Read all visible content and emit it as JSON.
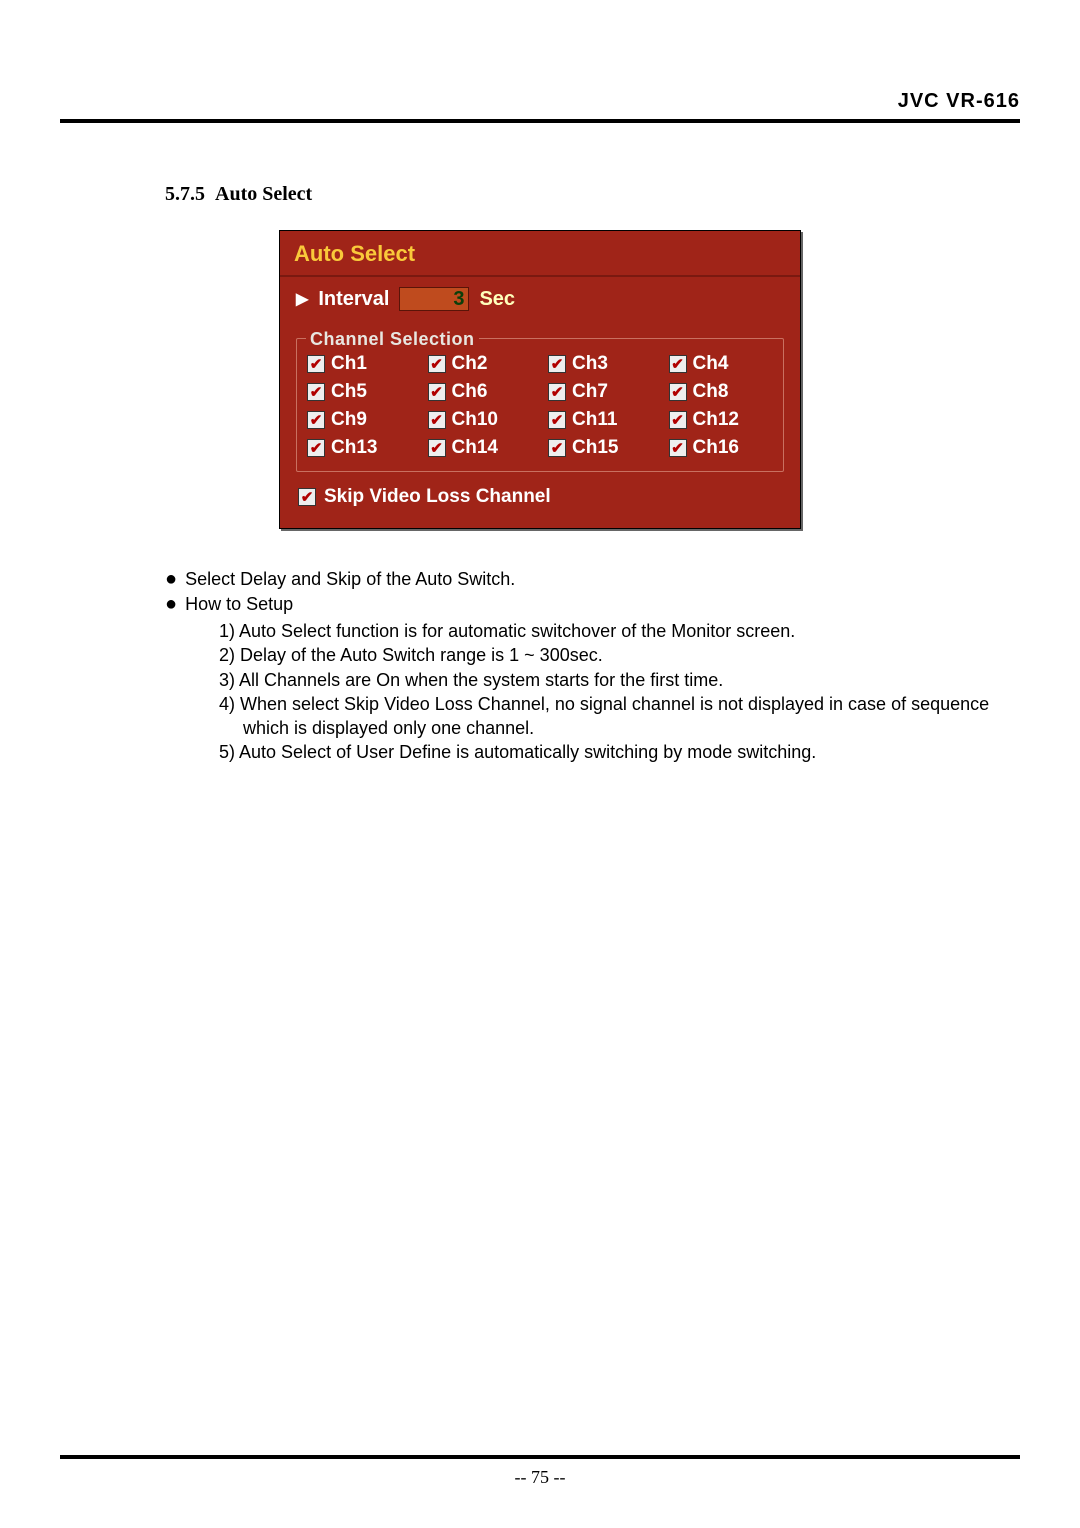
{
  "header": {
    "device": "JVC VR-616"
  },
  "section": {
    "num": "5.7.5",
    "title": "Auto Select"
  },
  "osd": {
    "title": "Auto Select",
    "interval_label": "Interval",
    "interval_value": "3",
    "interval_unit": "Sec",
    "channel_selection_label": "Channel Selection",
    "channels": [
      "Ch1",
      "Ch2",
      "Ch3",
      "Ch4",
      "Ch5",
      "Ch6",
      "Ch7",
      "Ch8",
      "Ch9",
      "Ch10",
      "Ch11",
      "Ch12",
      "Ch13",
      "Ch14",
      "Ch15",
      "Ch16"
    ],
    "skip_label": "Skip Video Loss Channel"
  },
  "notes": {
    "bullet1": "Select Delay and Skip of the Auto Switch.",
    "bullet2": "How to Setup",
    "setup": [
      "1) Auto Select function is for automatic switchover of the Monitor screen.",
      "2) Delay of the Auto Switch range is 1 ~ 300sec.",
      "3) All Channels are On when the system starts for the first time.",
      "4) When select Skip Video Loss Channel, no signal channel is not displayed in case of sequence which is displayed only one channel.",
      "5) Auto Select of User Define is automatically switching by mode switching."
    ]
  },
  "footer": {
    "page": "-- 75 --"
  }
}
